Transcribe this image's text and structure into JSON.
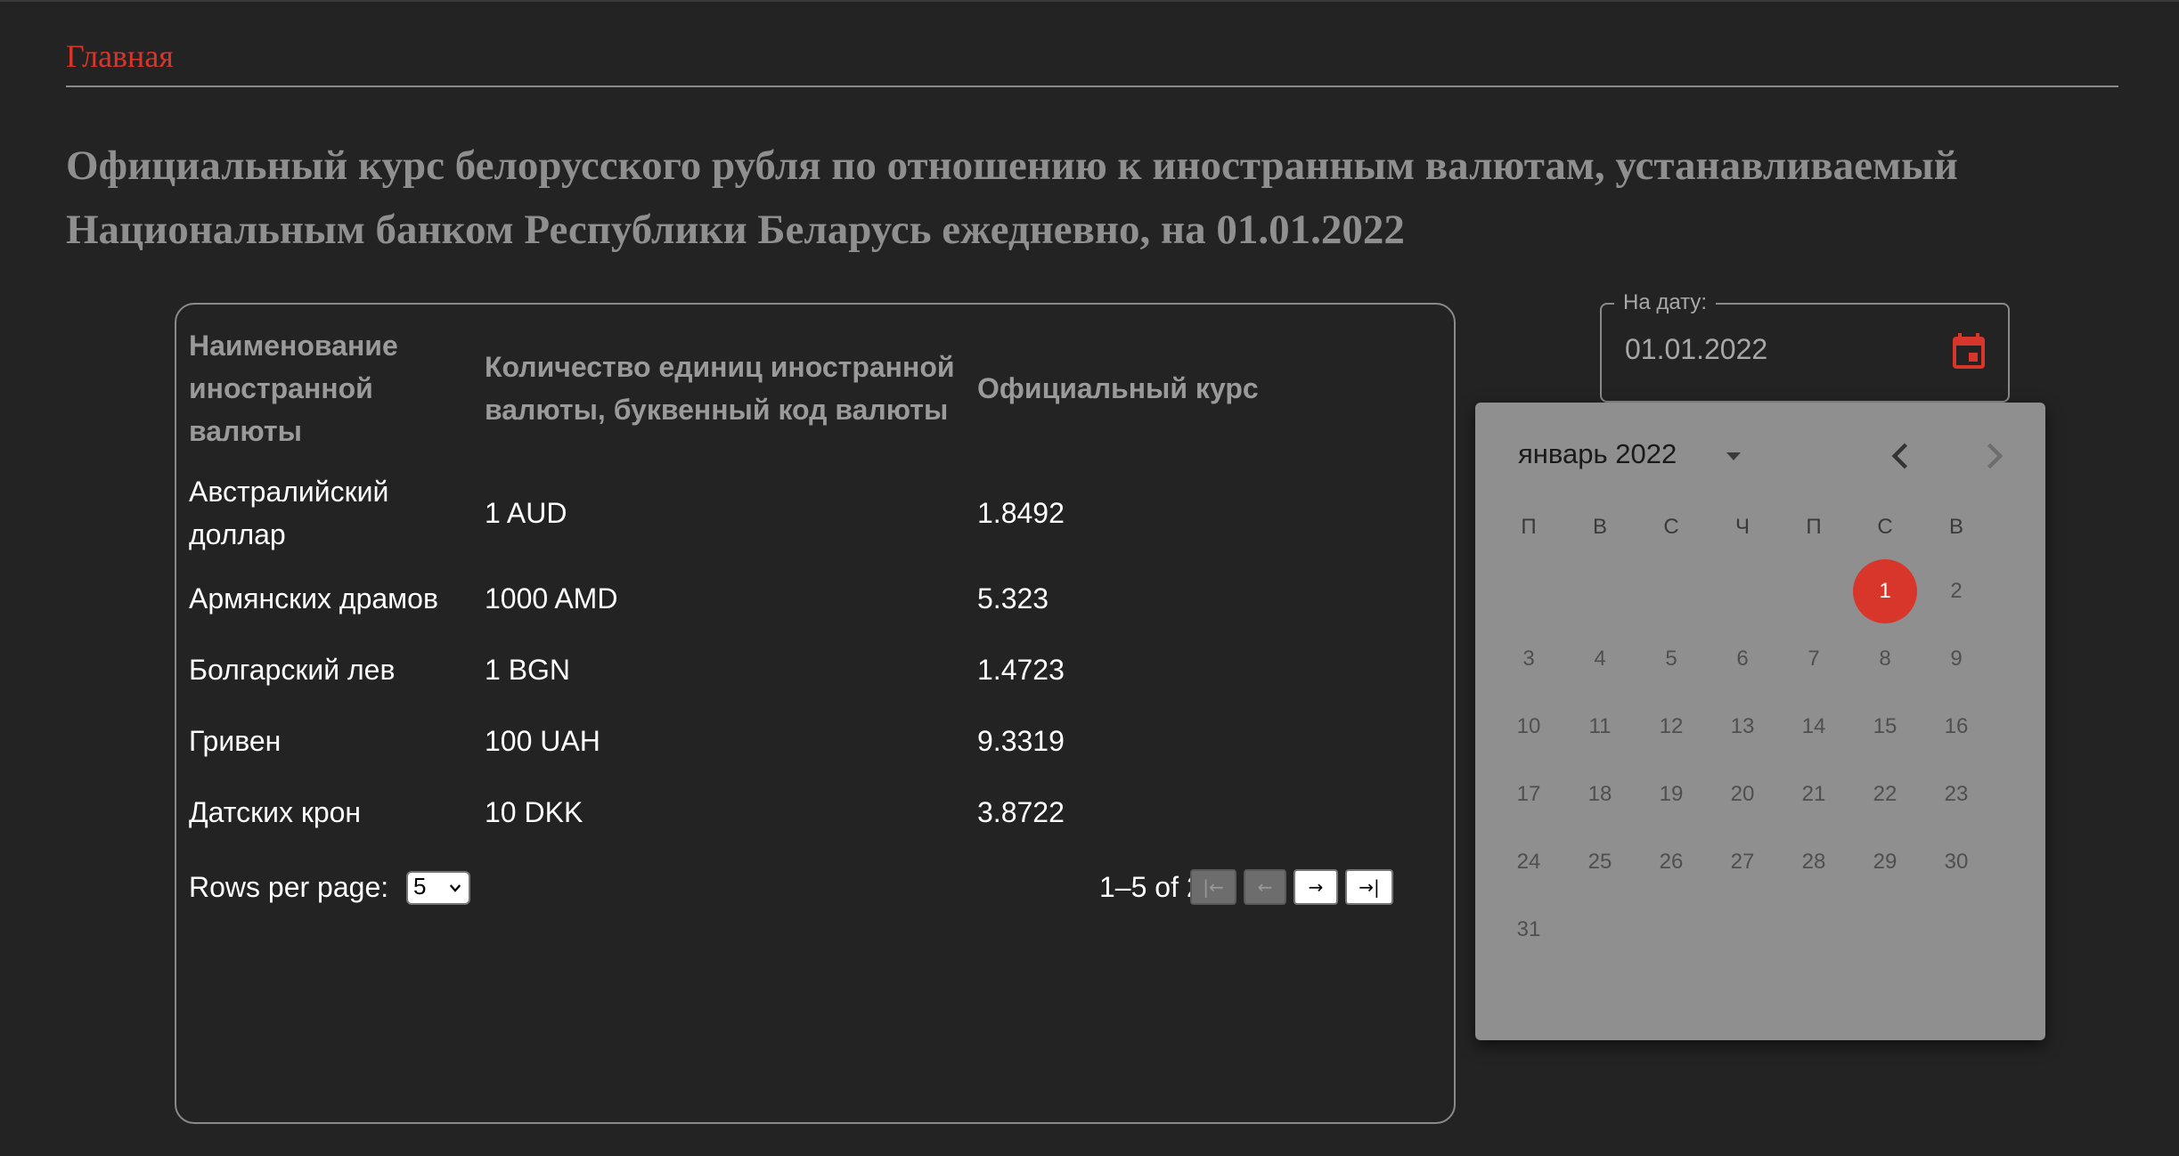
{
  "nav": {
    "home_label": "Главная"
  },
  "page_title": "Официальный курс белорусского рубля по отношению к иностранным валютам, устанавливаемый Национальным банком Республики Беларусь ежедневно, на 01.01.2022",
  "table": {
    "headers": {
      "name": "Наименование иностранной валюты",
      "units": "Количество единиц иностранной валюты, буквенный код валюты",
      "rate": "Официальный курс"
    },
    "rows": [
      {
        "name": "Австралийский доллар",
        "units": "1 AUD",
        "rate": "1.8492"
      },
      {
        "name": "Армянских драмов",
        "units": "1000 AMD",
        "rate": "5.323"
      },
      {
        "name": "Болгарский лев",
        "units": "1 BGN",
        "rate": "1.4723"
      },
      {
        "name": "Гривен",
        "units": "100 UAH",
        "rate": "9.3319"
      },
      {
        "name": "Датских крон",
        "units": "10 DKK",
        "rate": "3.8722"
      }
    ]
  },
  "pagination": {
    "rows_per_page_label": "Rows per page:",
    "rows_per_page_value": "5",
    "range_text": "1–5 of 27",
    "first_label": "|←",
    "prev_label": "←",
    "next_label": "→",
    "last_label": "→|"
  },
  "date_field": {
    "label": "На дату:",
    "value": "01.01.2022",
    "icon": "calendar-icon"
  },
  "calendar": {
    "month_label": "январь 2022",
    "weekdays": [
      "П",
      "В",
      "С",
      "Ч",
      "П",
      "С",
      "В"
    ],
    "first_weekday_index": 5,
    "days_in_month": 31,
    "selected_day": 1
  },
  "colors": {
    "background": "#232323",
    "accent": "#d8362a",
    "muted_text": "#8f8f8f",
    "calendar_bg": "#8f8f8f"
  }
}
